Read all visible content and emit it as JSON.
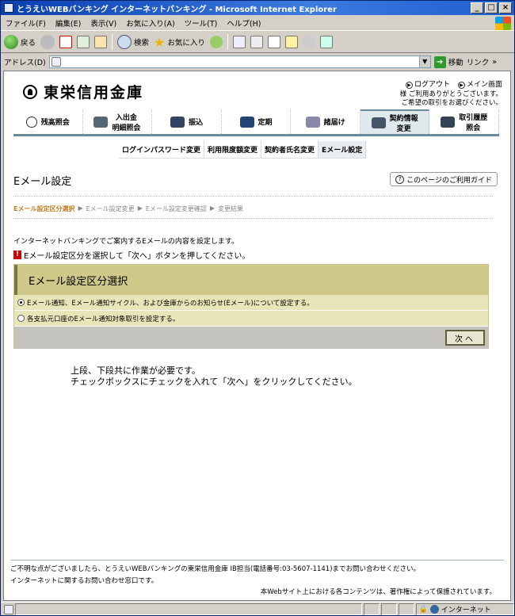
{
  "window": {
    "title": "とうえいWEBバンキング インターネットバンキング - Microsoft Internet Explorer"
  },
  "menu": [
    "ファイル(F)",
    "編集(E)",
    "表示(V)",
    "お気に入り(A)",
    "ツール(T)",
    "ヘルプ(H)"
  ],
  "toolbar": {
    "back": "戻る",
    "search": "検索",
    "favorites": "お気に入り"
  },
  "address": {
    "label": "アドレス(D)",
    "go": "移動",
    "links": "リンク"
  },
  "bank": {
    "name": "東栄信用金庫"
  },
  "toplinks": {
    "logout": "ログアウト",
    "main": "メイン画面"
  },
  "greeting": {
    "line1": "様 ご利用ありがとうございます。",
    "line2": "ご希望の取引をお選びください。"
  },
  "nav": [
    {
      "label": "残高照会"
    },
    {
      "label": "入出金\n明細照会"
    },
    {
      "label": "振込"
    },
    {
      "label": "定期"
    },
    {
      "label": "諸届け"
    },
    {
      "label": "契約情報\n変更"
    },
    {
      "label": "取引履歴\n照会"
    }
  ],
  "subnav": [
    "ログインパスワード変更",
    "利用限度額変更",
    "契約者氏名変更",
    "Eメール設定"
  ],
  "page": {
    "title": "Eメール設定",
    "guide": "このページのご利用ガイド",
    "steps": [
      "Eメール設定区分選択",
      "Eメール設定変更",
      "Eメール設定変更確認",
      "変更結果"
    ],
    "intro": "インターネットバンキングでご案内するEメールの内容を設定します。",
    "warn": "Eメール設定区分を選択して「次へ」ボタンを押してください。"
  },
  "panel": {
    "title": "Eメール設定区分選択",
    "option1": "Eメール通知、Eメール通知サイクル、および金庫からのお知らせ(Eメール)について設定する。",
    "option2": "各支払元口座のEメール通知対象取引を設定する。",
    "next": "次へ"
  },
  "note": {
    "line1": "上段、下段共に作業が必要です。",
    "line2": "チェックボックスにチェックを入れて「次へ」をクリックしてください。"
  },
  "footer": {
    "line1": "ご不明な点がございましたら、とうえいWEBバンキングの東栄信用金庫 IB担当(電話番号:03-5607-1141)までお問い合わせください。",
    "line2": "インターネットに関するお問い合わせ窓口です。",
    "line3": "本Webサイト上における各コンテンツは、著作権によって保護されています。"
  },
  "status": {
    "zone": "インターネット"
  }
}
